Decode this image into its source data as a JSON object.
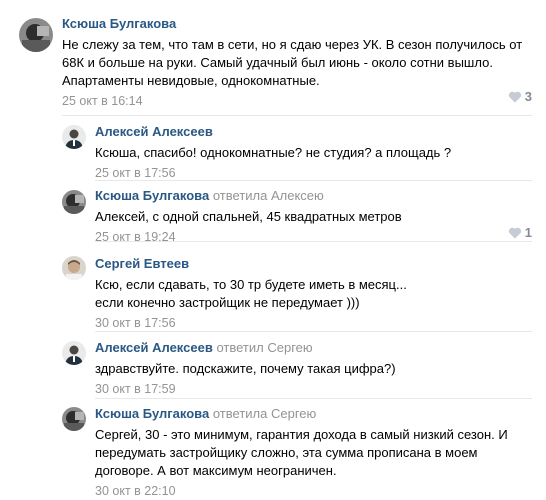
{
  "comments": [
    {
      "author": "Ксюша Булгакова",
      "reply_verb": "",
      "reply_target": "",
      "text": "Не слежу за тем, что там в сети, но я сдаю через УК. В сезон получилось от 68К и больше на руки. Самый удачный был июнь - около сотни вышло. Апартаменты невидовые, однокомнатные.",
      "date": "25 окт в 16:14",
      "likes": "3"
    },
    {
      "author": "Алексей Алексеев",
      "reply_verb": "",
      "reply_target": "",
      "text": "Ксюша, спасибо! однокомнатные? не студия? а площадь ?",
      "date": "25 окт в 17:56",
      "likes": ""
    },
    {
      "author": "Ксюша Булгакова",
      "reply_verb": "ответила",
      "reply_target": "Алексею",
      "text": "Алексей, с одной спальней, 45 квадратных метров",
      "date": "25 окт в 19:24",
      "likes": "1"
    },
    {
      "author": "Сергей Евтеев",
      "reply_verb": "",
      "reply_target": "",
      "text": "Ксю, если сдавать, то 30 тр будете иметь в месяц... если конечно застройщик не передумает )))",
      "date": "30 окт в 17:56",
      "likes": ""
    },
    {
      "author": "Алексей Алексеев",
      "reply_verb": "ответил",
      "reply_target": "Сергею",
      "text": "здравствуйте. подскажите, почему такая цифра?)",
      "date": "30 окт в 17:59",
      "likes": ""
    },
    {
      "author": "Ксюша Булгакова",
      "reply_verb": "ответила",
      "reply_target": "Сергею",
      "text": "Сергей, 30 - это минимум, гарантия дохода в самый низкий сезон. И передумать застройщику сложно, эта сумма прописана в моем договоре. А вот максимум неограничен.",
      "date": "30 окт в 22:10",
      "likes": ""
    }
  ],
  "icons": {
    "like": "heart-icon"
  },
  "colors": {
    "author": "#2a5885",
    "muted": "#939393",
    "separator": "#e7e8ec"
  }
}
